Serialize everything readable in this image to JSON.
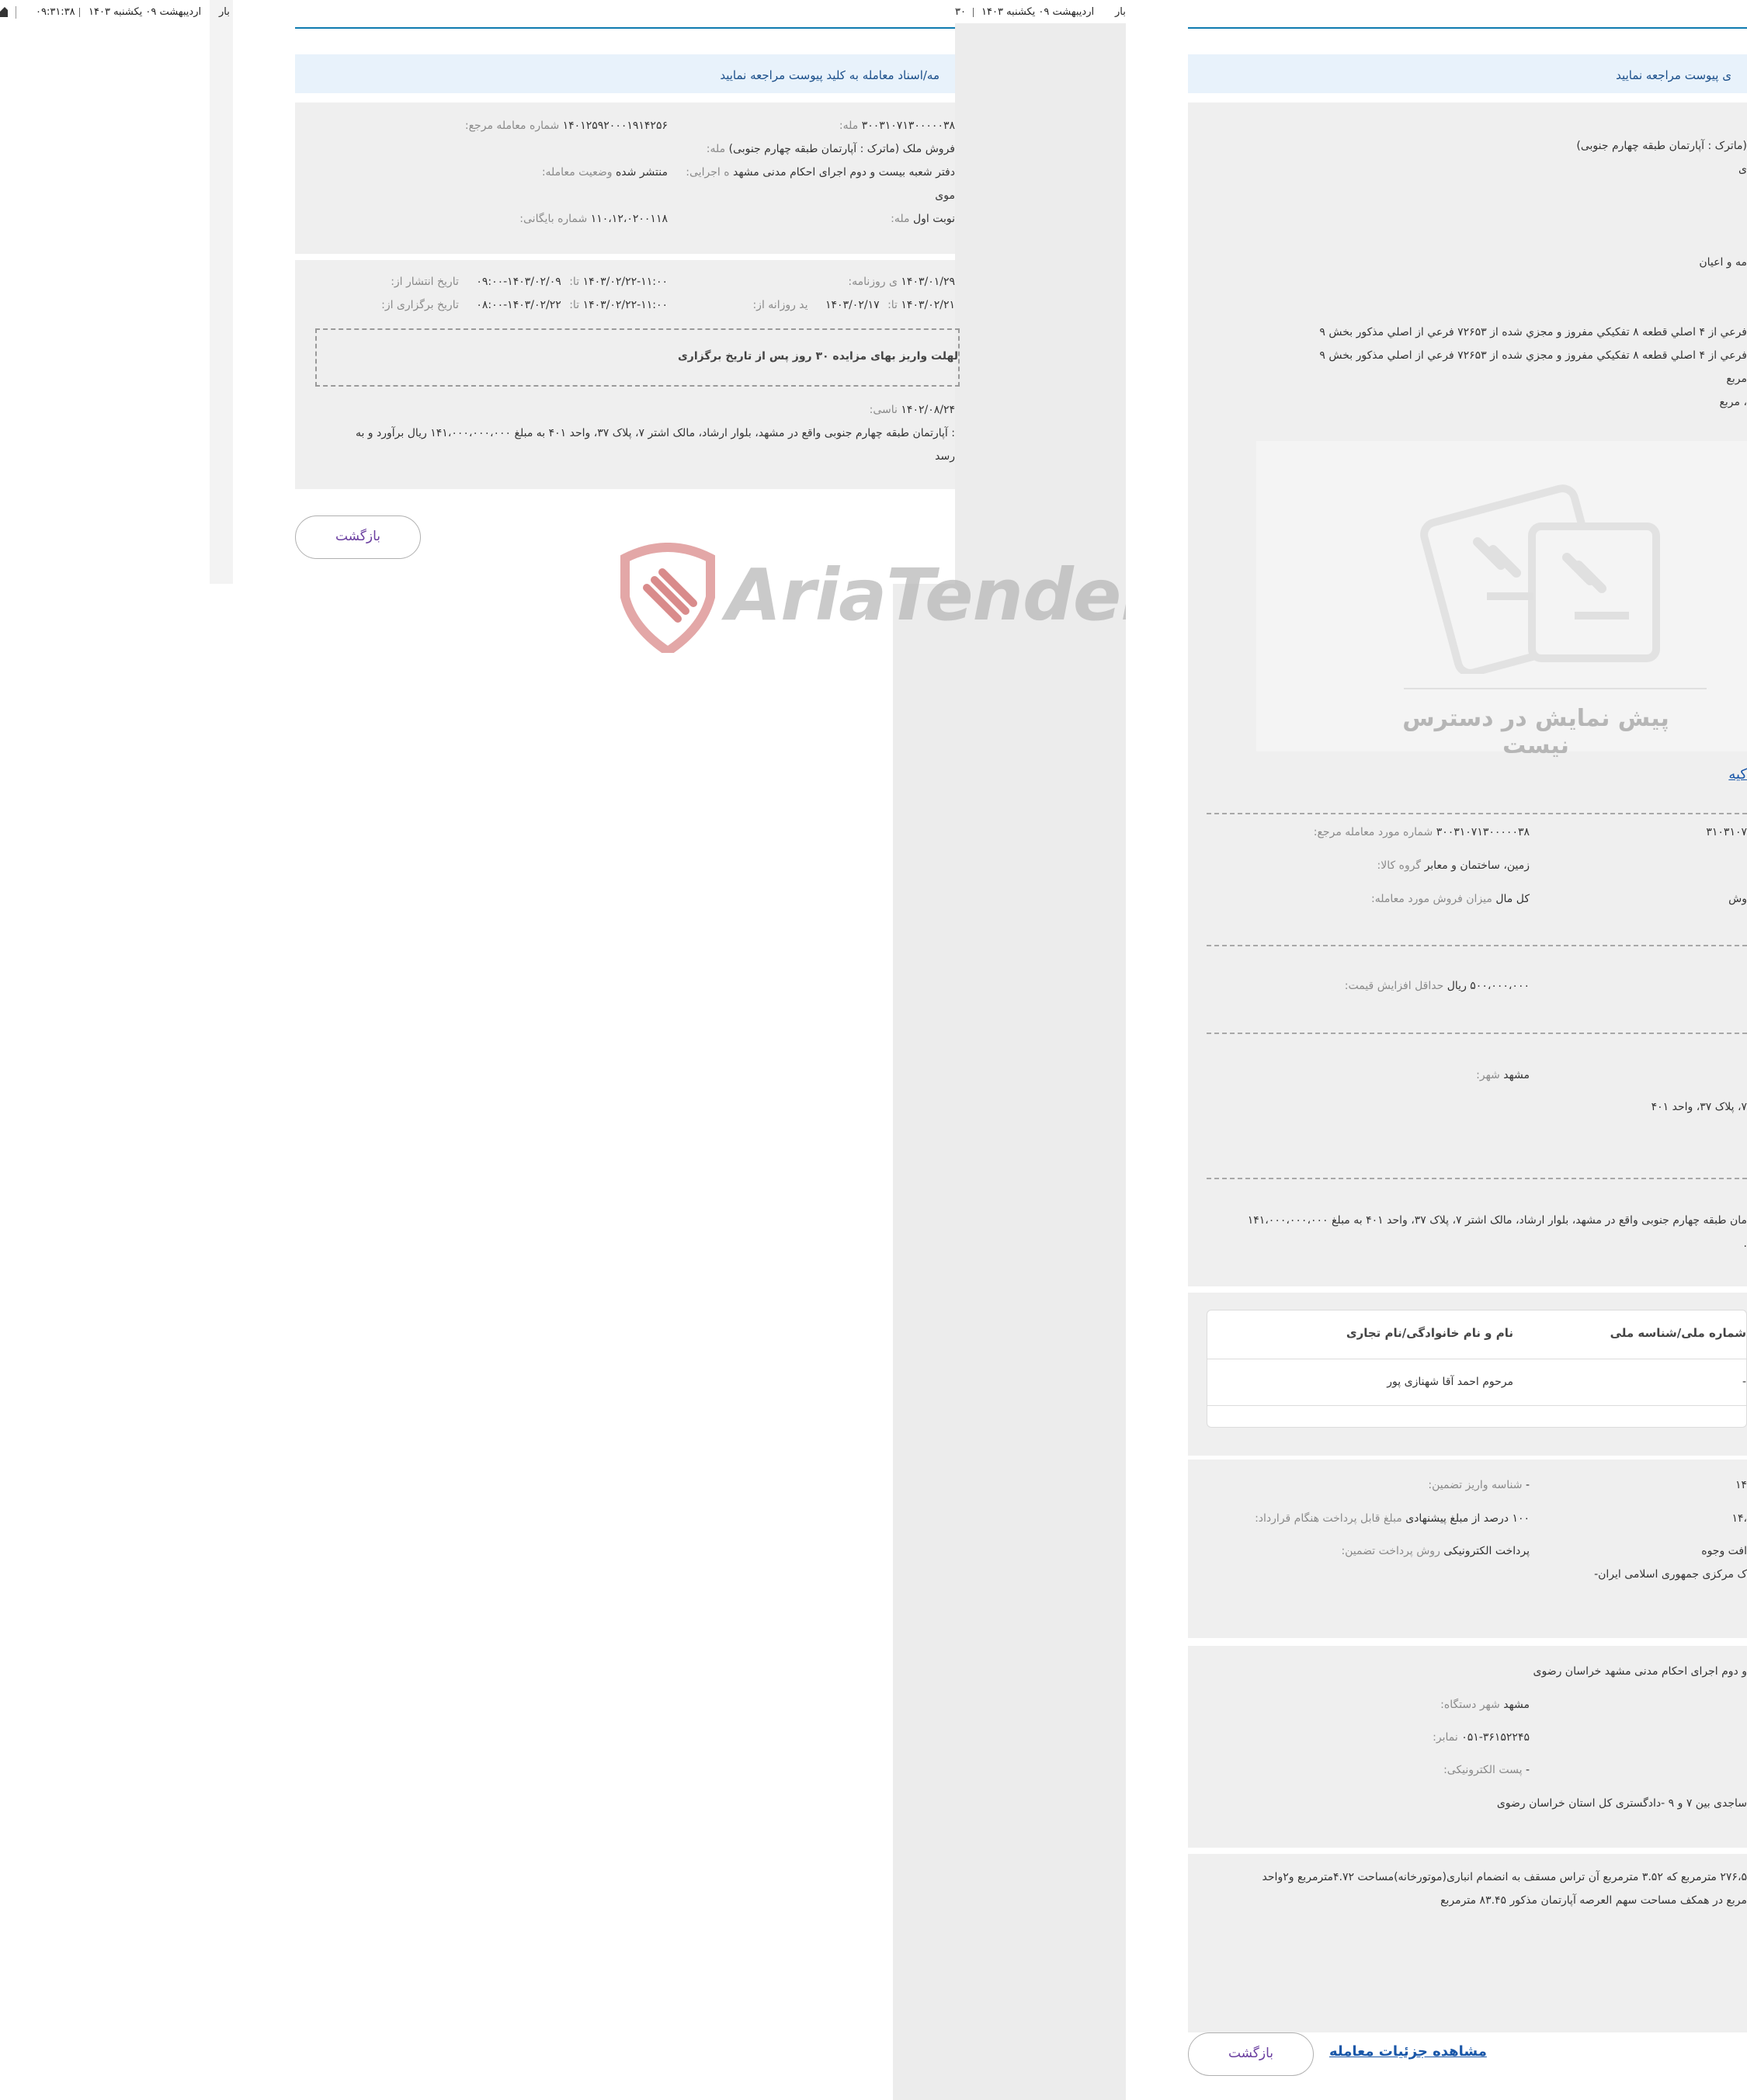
{
  "left_panel": {
    "topbar_date": "اردیبهشت ۰۹ یکشنبه ۱۴۰۳",
    "topbar_time": "۰۹:۳۱:۳۸",
    "topbar_extra": "بار"
  },
  "middle_panel": {
    "topbar_date": "اردیبهشت ۰۹ یکشنبه ۱۴۰۳",
    "topbar_fragment": "۳۰",
    "topbar_extra": "بار",
    "notice": "مه/اسناد معامله به کلید پیوست مراجعه نمایید",
    "info": {
      "deal_number_label": "مله:",
      "deal_number": "۳۰۰۳۱۰۷۱۳۰۰۰۰۰۳۸",
      "ref_number_label": "شماره معامله مرجع:",
      "ref_number": "۱۴۰۱۲۵۹۲۰۰۰۱۹۱۴۲۵۶",
      "title_label": "مله:",
      "title": "فروش ملک (ماترک : آپارتمان طبقه چهارم جنوبی)",
      "exec_label": "ه اجرایی:",
      "exec": "دفتر شعبه بیست و دوم اجرای احکام مدنی مشهد",
      "status_label": "وضعیت معامله:",
      "status": "منتشر شده",
      "exec_cont": "موی",
      "round_label": "مله:",
      "round": "نوبت اول",
      "archive_label": "شماره بایگانی:",
      "archive": "۱۱۰،۱۲،۰۲۰۰۱۱۸"
    },
    "dates": {
      "newspaper_label": "ی روزنامه:",
      "newspaper": "۱۴۰۳/۰۱/۲۹",
      "publish_label": "تاریخ انتشار از:",
      "publish_from": "۱۴۰۳/۰۲/۰۹-۰۹:۰۰",
      "to_label": "تا:",
      "publish_to": "۱۴۰۳/۰۲/۲۲-۱۱:۰۰",
      "visit_label": "ید روزانه از:",
      "visit_from": "۱۴۰۳/۰۲/۱۷",
      "visit_to": "۱۴۰۳/۰۲/۲۱",
      "hold_label": "تاریخ برگزاری از:",
      "hold_from": "۱۴۰۳/۰۲/۲۲-۰۸:۰۰",
      "hold_to": "۱۴۰۳/۰۲/۲۲-۱۱:۰۰",
      "deadline_note": "لهلت واریز بهای مزایده ۳۰ روز پس از تاریخ برگزاری",
      "expert_label": "ناسی:",
      "expert_date": "۱۴۰۲/۰۸/۲۴",
      "desc1": ": آپارتمان طبقه چهارم جنوبی واقع در مشهد، بلوار ارشاد، مالک اشتر ۷، پلاک ۳۷، واحد ۴۰۱ به مبلغ ۱۴۱،۰۰۰،۰۰۰،۰۰۰ ریال برآورد و به",
      "desc2": "رسد"
    },
    "back_button": "بازگشت"
  },
  "watermark": {
    "text": "AriaTender.neT"
  },
  "right_panel": {
    "notice": "ی پیوست مراجعه نمایید",
    "lines": {
      "l1": "(ماترک : آپارتمان طبقه چهارم جنوبی)",
      "l2": "ی",
      "l3": "مه و اعیان",
      "l4": "فرعي از ۴ اصلي قطعه ۸ تفکيکي مفروز و مجزي شده از ۷۲۶۵۳ فرعي از اصلي مذکور بخش ۹",
      "l5": "فرعي از ۴ اصلي قطعه ۸ تفکيکي مفروز و مجزي شده از ۷۲۶۵۳ فرعي از اصلي مذکور بخش ۹",
      "l6": "مربع",
      "l7": "، مربع"
    },
    "preview_text": "پیش نمایش در دسترس نیست",
    "attach_link": "کیه",
    "ref_item_label": "شماره مورد معامله مرجع:",
    "ref_item": "۳۰۰۳۱۰۷۱۳۰۰۰۰۰۳۸",
    "ref_item_right": "۳۱۰۳۱۰۷",
    "group_label": "گروه کالا:",
    "group": "زمین، ساختمان و معابر",
    "sale_label": "میزان فروش مورد معامله:",
    "sale": "کل مال",
    "sale_right": "وش",
    "min_inc_label": "حداقل افزایش قیمت:",
    "min_inc": "۵۰۰،۰۰۰،۰۰۰ ریال",
    "city_label": "شهر:",
    "city": "مشهد",
    "addr_frag": "۷، پلاک ۳۷، واحد ۴۰۱",
    "desc1": "مان طبقه چهارم جنوبی واقع در مشهد، بلوار ارشاد، مالک اشتر ۷، پلاک ۳۷، واحد ۴۰۱ به مبلغ ۱۴۱،۰۰۰،۰۰۰،۰۰۰",
    "desc2": ".",
    "table": {
      "col_id": "شماره ملی/شناسه ملی",
      "col_name": "نام و نام خانوادگی/نام تجاری",
      "row_name": "مرحوم احمد آقا شهنازی پور",
      "row_id": "-"
    },
    "pay": {
      "deposit_id_label": "شناسه واریز تضمین:",
      "deposit_id": "-",
      "right1": "۱۴",
      "contract_label": "مبلغ قابل پرداخت هنگام قرارداد:",
      "contract": "۱۰۰ درصد از مبلغ پیشنهادی",
      "right2": "۱۴،",
      "method_label": "روش پرداخت تضمین:",
      "method": "پرداخت الکترونیکی",
      "right3": "افت وجوه",
      "bank": "ک مرکزی جمهوری اسلامی ایران-"
    },
    "org": {
      "name": "و دوم اجرای احکام مدنی مشهد خراسان رضوی",
      "city_label": "شهر دستگاه:",
      "city": "مشهد",
      "fax_label": "نمابر:",
      "fax": "۰۵۱-۳۶۱۵۲۲۴۵",
      "email_label": "پست الکترونیکی:",
      "email": "-",
      "address": "ساجدی بین ۷ و ۹ -دادگستری کل استان خراسان رضوی"
    },
    "area": {
      "line1": "۲۷۶،۵ مترمربع که ۳.۵۲ مترمربع آن تراس مسقف به انضمام انباری(موتورخانه)مساحت ۴.۷۲مترمربع و۲واحد",
      "line2": "مربع در همکف مساحت سهم العرصه آپارتمان مذکور ۸۳.۴۵ مترمربع"
    },
    "view_details": "مشاهده جزئیات معامله",
    "back_button": "بازگشت"
  }
}
